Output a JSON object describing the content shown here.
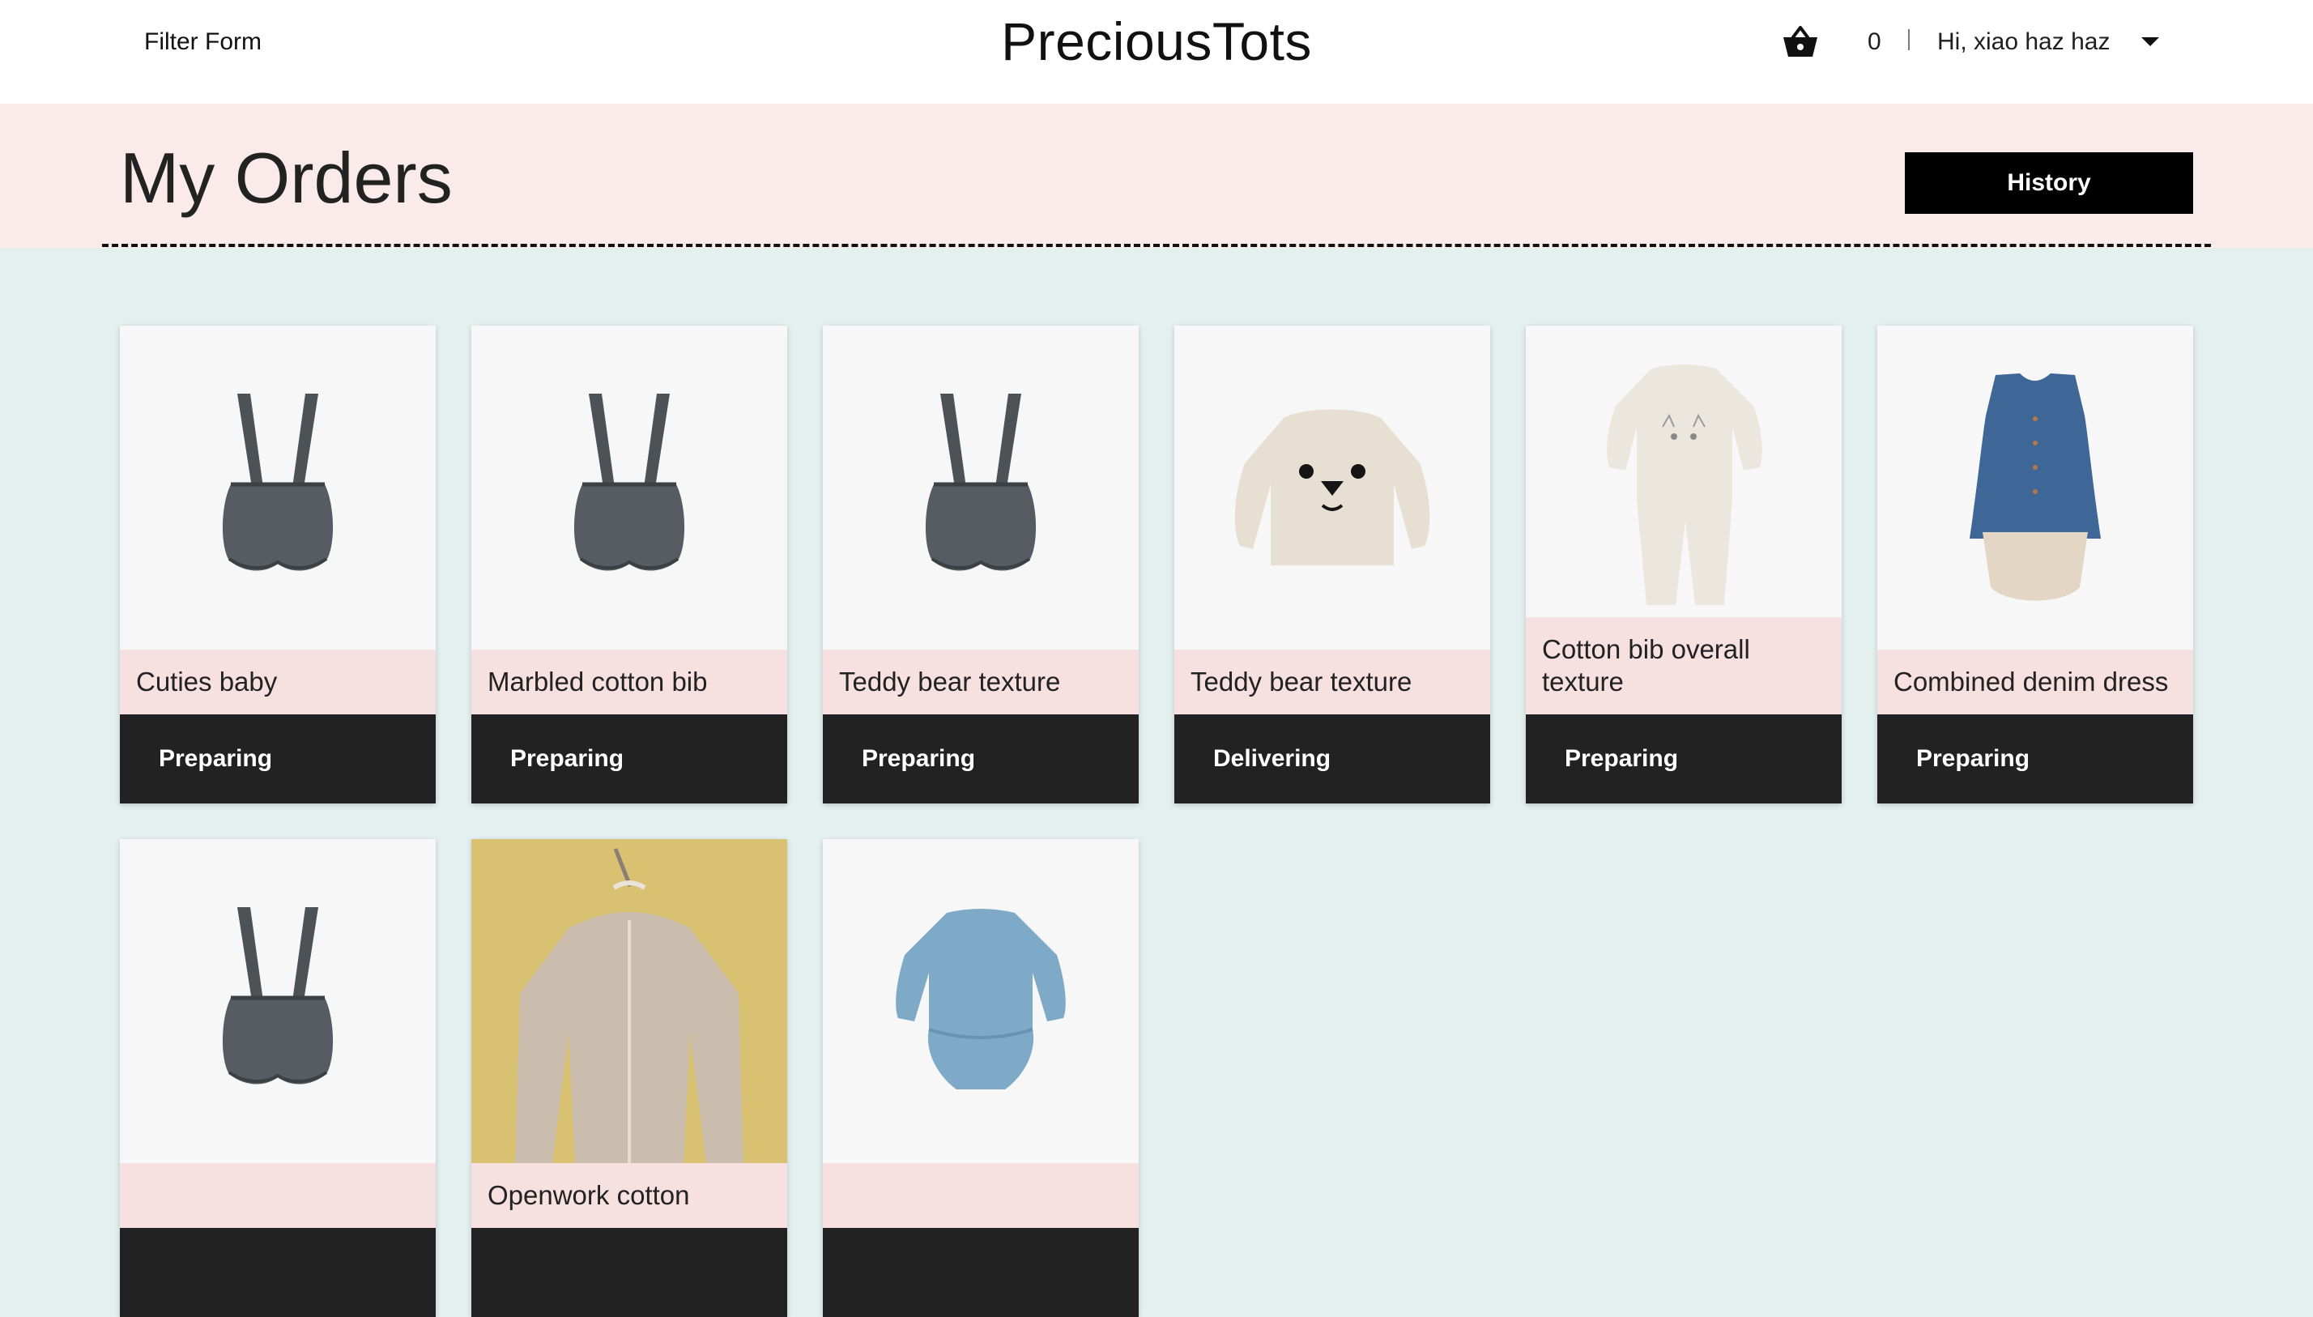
{
  "header": {
    "filter_link": "Filter Form",
    "brand": "PreciousTots",
    "cart_count": "0",
    "greeting": "Hi, xiao haz haz"
  },
  "page": {
    "title": "My Orders",
    "history_button": "History"
  },
  "orders": [
    {
      "name": "Cuties baby",
      "status": "Preparing",
      "image": "overall-shorts"
    },
    {
      "name": "Marbled cotton bib",
      "status": "Preparing",
      "image": "overall-shorts"
    },
    {
      "name": "Teddy bear texture",
      "status": "Preparing",
      "image": "overall-shorts"
    },
    {
      "name": "Teddy bear texture",
      "status": "Delivering",
      "image": "bear-sweater"
    },
    {
      "name": "Cotton bib overall texture",
      "status": "Preparing",
      "image": "cat-romper"
    },
    {
      "name": "Combined denim dress",
      "status": "Preparing",
      "image": "denim-dress"
    },
    {
      "name": "",
      "status": "",
      "image": "overall-shorts"
    },
    {
      "name": "Openwork cotton",
      "status": "",
      "image": "knit-cardigan"
    },
    {
      "name": "",
      "status": "",
      "image": "blue-bodysuit"
    }
  ],
  "colors": {
    "background": "#e3f0ef",
    "banner": "#fbeaea",
    "card_label": "#f7dfdf",
    "status_bar": "#222222",
    "button": "#000000"
  }
}
